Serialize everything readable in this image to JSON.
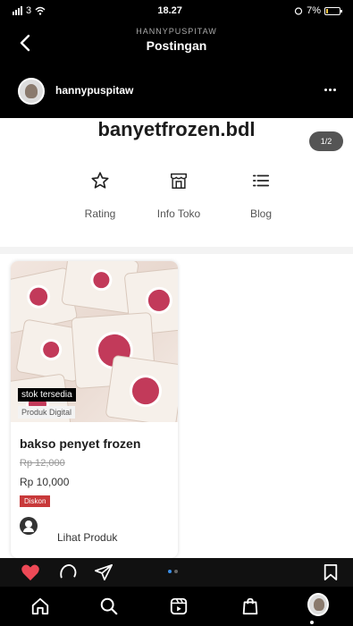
{
  "status_bar": {
    "carrier": "3",
    "time": "18.27",
    "battery": "7%"
  },
  "header": {
    "subtitle": "HANNYPUSPITAW",
    "title": "Postingan"
  },
  "post": {
    "username": "hannypuspitaw"
  },
  "shop": {
    "name": "banyetfrozen.bdl",
    "count_badge": "1/2",
    "tabs": [
      {
        "label": "Rating",
        "icon": "star-icon"
      },
      {
        "label": "Info Toko",
        "icon": "store-icon"
      },
      {
        "label": "Blog",
        "icon": "list-icon"
      }
    ]
  },
  "product": {
    "stock_badge": "stok tersedia",
    "type_badge": "Produk Digital",
    "name": "bakso penyet frozen",
    "original_price": "Rp 12,000",
    "price": "Rp 10,000",
    "discount_label": "Diskon",
    "view_label": "Lihat Produk"
  },
  "action_bar": {
    "icons": [
      "heart-icon",
      "comment-icon",
      "share-icon",
      "bookmark-icon"
    ],
    "colors": {
      "heart": "#ed4956"
    }
  },
  "tab_bar": {
    "icons": [
      "home-icon",
      "search-icon",
      "reels-icon",
      "shop-icon",
      "profile-icon"
    ]
  }
}
